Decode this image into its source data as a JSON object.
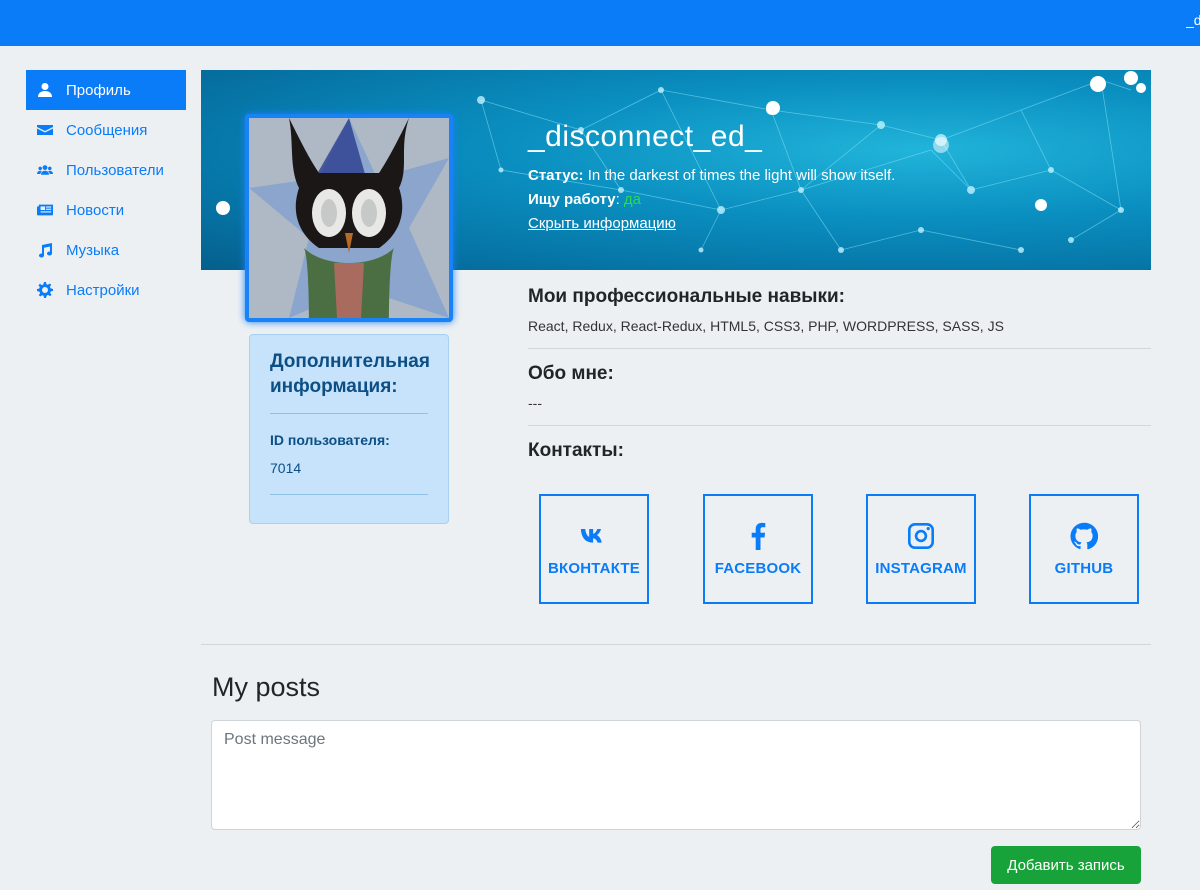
{
  "header": {
    "user_label": "_disconnect_ed_"
  },
  "sidebar": {
    "items": [
      {
        "label": "Профиль",
        "icon": "user-icon",
        "active": true
      },
      {
        "label": "Сообщения",
        "icon": "envelope-icon"
      },
      {
        "label": "Пользователи",
        "icon": "users-icon"
      },
      {
        "label": "Новости",
        "icon": "newspaper-icon"
      },
      {
        "label": "Музыка",
        "icon": "music-icon"
      },
      {
        "label": "Настройки",
        "icon": "gear-icon"
      }
    ]
  },
  "profile": {
    "name": "_disconnect_ed_",
    "status_label": "Статус:",
    "status_text": "In the darkest of times the light will show itself.",
    "job_label": "Ищу работу",
    "job_colon": ":",
    "job_value": "да",
    "hide_info": "Скрыть информацию"
  },
  "info_card": {
    "title": "Дополнительная информация:",
    "id_label": "ID пользователя:",
    "id_value": "7014"
  },
  "details": {
    "skills_title": "Мои профессиональные навыки:",
    "skills_text": "React, Redux, React-Redux, HTML5, CSS3, PHP, WORDPRESS, SASS, JS",
    "about_title": "Обо мне:",
    "about_text": "---",
    "contacts_title": "Контакты:"
  },
  "contacts": [
    {
      "label": "ВКОНТАКТЕ",
      "icon": "vk-icon"
    },
    {
      "label": "FACEBOOK",
      "icon": "facebook-icon"
    },
    {
      "label": "INSTAGRAM",
      "icon": "instagram-icon"
    },
    {
      "label": "GITHUB",
      "icon": "github-icon"
    }
  ],
  "posts": {
    "title": "My posts",
    "placeholder": "Post message",
    "add_button": "Добавить запись"
  },
  "colors": {
    "primary": "#0a7cf8",
    "success": "#18a33a",
    "job_yes": "#2bd94b",
    "info_card_bg": "#c6e3fb"
  }
}
